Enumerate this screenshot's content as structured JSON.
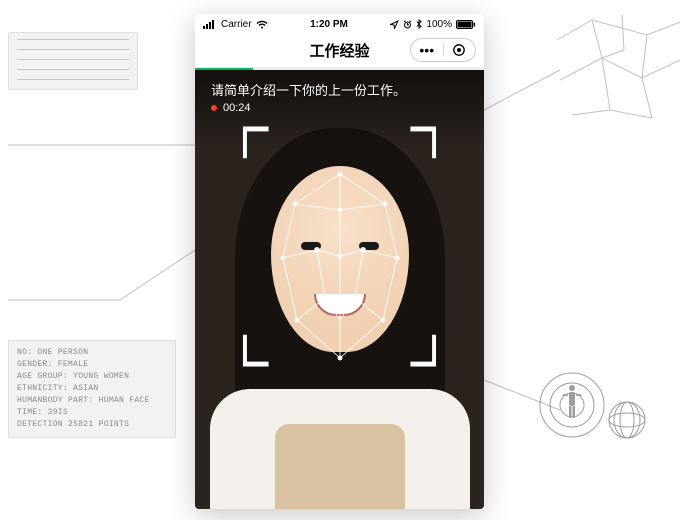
{
  "status_bar": {
    "carrier": "Carrier",
    "time": "1:20 PM",
    "battery": "100%"
  },
  "nav": {
    "title": "工作经验"
  },
  "progress": {
    "percent": 20
  },
  "camera": {
    "prompt": "请简单介绍一下你的上一份工作。",
    "timer": "00:24"
  },
  "detection_panel": {
    "lines": [
      "NO: ONE PERSON",
      "GENDER: FEMALE",
      "AGE GROUP: YOUNG WOMEN",
      "ETHNICITY: ASIAN",
      "HUMANBODY PART: HUMAN FACE",
      "TIME: 39IS",
      "DETECTION 25821 POINTS"
    ]
  },
  "colors": {
    "accent_green": "#09b35b",
    "record_red": "#ff3b30"
  }
}
